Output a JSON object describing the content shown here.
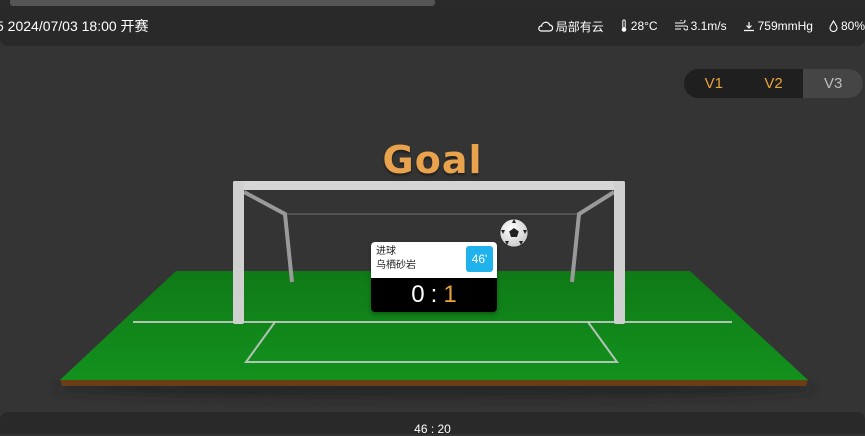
{
  "header": {
    "match_time": "5 2024/07/03 18:00 开赛",
    "weather": {
      "condition": "局部有云",
      "temperature": "28°C",
      "wind": "3.1m/s",
      "pressure": "759mmHg",
      "humidity": "80%"
    }
  },
  "version_switch": {
    "options": [
      "V1",
      "V2",
      "V3"
    ],
    "active": "V3"
  },
  "animation": {
    "title": "Goal",
    "event": {
      "type": "进球",
      "player": "乌栖砂岩",
      "minute": "46'",
      "score_home": "0",
      "score_separator": ":",
      "score_away": "1"
    }
  },
  "footer": {
    "elapsed": "46 : 20"
  },
  "colors": {
    "accent_orange": "#e7a437",
    "badge_blue": "#1fb2ec",
    "pitch_green": "#138a1d"
  }
}
